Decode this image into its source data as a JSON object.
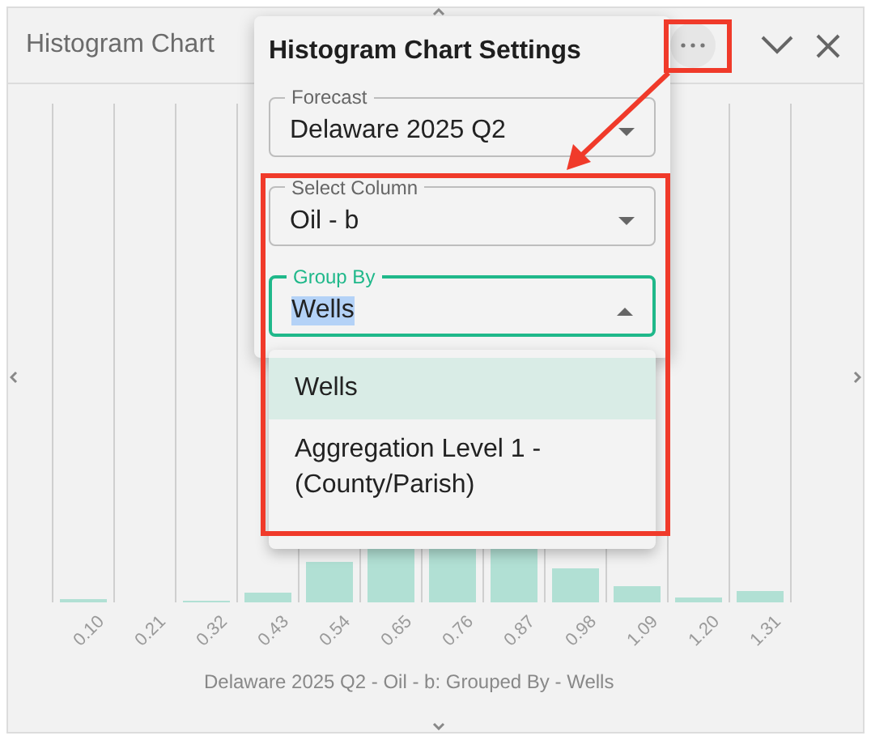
{
  "panel": {
    "title": "Histogram Chart"
  },
  "chart": {
    "x_labels": [
      "0.10",
      "0.21",
      "0.32",
      "0.43",
      "0.54",
      "0.65",
      "0.76",
      "0.87",
      "0.98",
      "1.09",
      "1.20",
      "1.31"
    ],
    "caption": "Delaware 2025 Q2 - Oil - b: Grouped By - Wells"
  },
  "settings": {
    "title": "Histogram Chart Settings",
    "fields": [
      {
        "label": "Forecast",
        "value": "Delaware 2025 Q2",
        "focused": false
      },
      {
        "label": "Select Column",
        "value": "Oil - b",
        "focused": false
      },
      {
        "label": "Group By",
        "value": "Wells",
        "focused": true
      }
    ],
    "menu": [
      {
        "label": "Wells",
        "selected": true
      },
      {
        "label": "Aggregation Level 1 - (County/Parish)",
        "selected": false
      }
    ]
  }
}
